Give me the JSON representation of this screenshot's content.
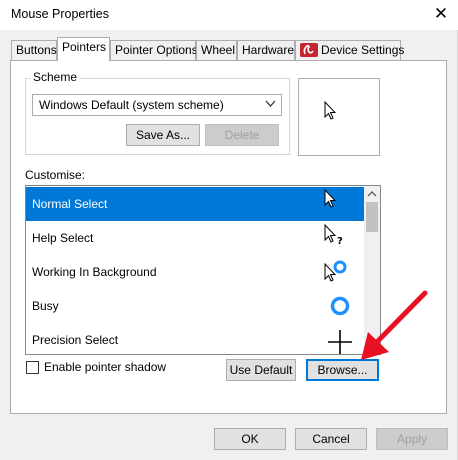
{
  "window": {
    "title": "Mouse Properties",
    "close_glyph": "✕"
  },
  "tabs": [
    {
      "label": "Buttons"
    },
    {
      "label": "Pointers"
    },
    {
      "label": "Pointer Options"
    },
    {
      "label": "Wheel"
    },
    {
      "label": "Hardware"
    },
    {
      "label": "Device Settings",
      "icon": "synaptics-icon"
    }
  ],
  "scheme": {
    "legend": "Scheme",
    "selected": "Windows Default (system scheme)",
    "save_as": "Save As...",
    "delete": "Delete"
  },
  "customise": {
    "label": "Customise:",
    "rows": [
      {
        "label": "Normal Select",
        "icon": "arrow-cursor-icon"
      },
      {
        "label": "Help Select",
        "icon": "help-cursor-icon"
      },
      {
        "label": "Working In Background",
        "icon": "working-cursor-icon"
      },
      {
        "label": "Busy",
        "icon": "busy-cursor-icon"
      },
      {
        "label": "Precision Select",
        "icon": "crosshair-cursor-icon"
      }
    ],
    "selected_index": 0
  },
  "shadow": {
    "label": "Enable pointer shadow",
    "checked": false
  },
  "buttons": {
    "use_default": "Use Default",
    "browse": "Browse..."
  },
  "footer": {
    "ok": "OK",
    "cancel": "Cancel",
    "apply": "Apply"
  },
  "colors": {
    "accent": "#0078d7",
    "annotation_arrow": "#e81123",
    "synaptics": "#c4262e"
  }
}
